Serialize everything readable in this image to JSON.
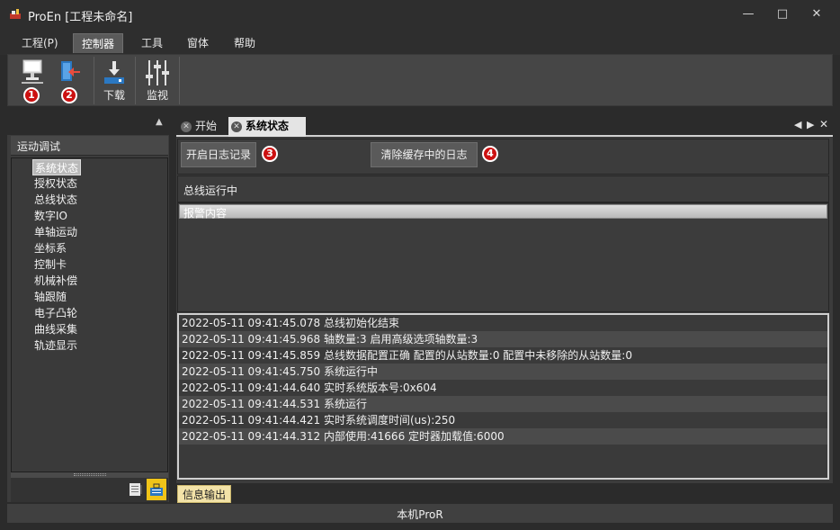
{
  "window": {
    "title": "ProEn [工程未命名]",
    "minimize_icon": "minimize-icon",
    "maximize_icon": "maximize-icon",
    "close_icon": "close-icon"
  },
  "menu": {
    "items": [
      {
        "label": "工程(P)"
      },
      {
        "label": "控制器",
        "active": true
      },
      {
        "label": "工具"
      },
      {
        "label": "窗体"
      },
      {
        "label": "帮助"
      }
    ]
  },
  "ribbon": {
    "buttons": [
      {
        "icon": "connect-computer-icon",
        "label": "",
        "badge": "1"
      },
      {
        "icon": "disconnect-exit-icon",
        "label": "",
        "badge": "2"
      },
      {
        "icon": "download-icon",
        "label": "下载"
      },
      {
        "icon": "monitor-sliders-icon",
        "label": "监视"
      }
    ]
  },
  "left_panel": {
    "title": "运动调试",
    "items": [
      {
        "label": "系统状态",
        "selected": true
      },
      {
        "label": "授权状态"
      },
      {
        "label": "总线状态"
      },
      {
        "label": "数字IO"
      },
      {
        "label": "单轴运动"
      },
      {
        "label": "坐标系"
      },
      {
        "label": "控制卡"
      },
      {
        "label": "机械补偿"
      },
      {
        "label": "轴跟随"
      },
      {
        "label": "电子凸轮"
      },
      {
        "label": "曲线采集"
      },
      {
        "label": "轨迹显示"
      }
    ]
  },
  "tabs": [
    {
      "label": "开始"
    },
    {
      "label": "系统状态",
      "active": true
    }
  ],
  "content": {
    "start_log_button": "开启日志记录",
    "start_log_badge": "3",
    "clear_log_button": "清除缓存中的日志",
    "clear_log_badge": "4",
    "status_text": "总线运行中",
    "alarm_header": "报警内容",
    "log_lines": [
      "2022-05-11  09:41:45.078 总线初始化结束",
      "2022-05-11  09:41:45.968 轴数量:3 启用高级选项轴数量:3",
      "2022-05-11  09:41:45.859 总线数据配置正确 配置的从站数量:0 配置中未移除的从站数量:0",
      "2022-05-11  09:41:45.750 系统运行中",
      "2022-05-11  09:41:44.640 实时系统版本号:0x604",
      "2022-05-11  09:41:44.531 系统运行",
      "2022-05-11  09:41:44.421 实时系统调度时间(us):250",
      "2022-05-11  09:41:44.312 内部使用:41666 定时器加载值:6000"
    ]
  },
  "output_tab": "信息输出",
  "statusbar": "本机ProR",
  "colors": {
    "badge": "#cc1111",
    "accent_tab": "#f3e3a8",
    "background": "#2b2b2b"
  }
}
